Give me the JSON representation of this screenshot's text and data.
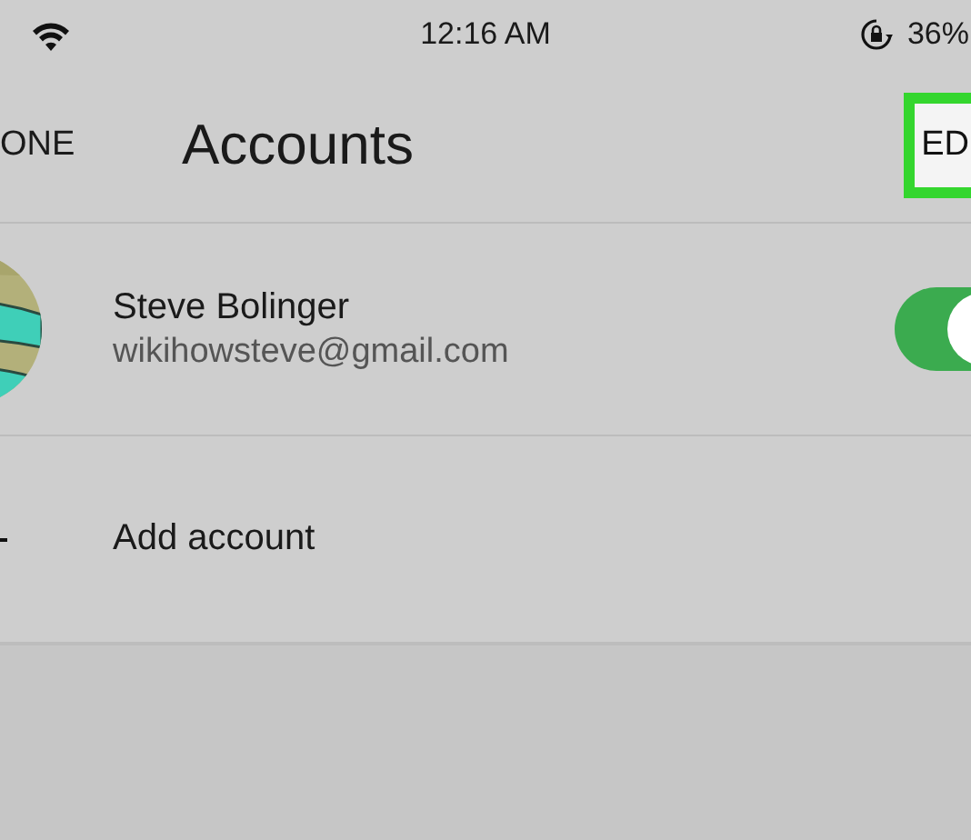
{
  "status_bar": {
    "time": "12:16 AM",
    "battery": "36%"
  },
  "nav": {
    "left_button": "ONE",
    "title": "Accounts",
    "right_button": "ED",
    "right_highlighted": true
  },
  "accounts": [
    {
      "name": "Steve Bolinger",
      "email": "wikihowsteve@gmail.com",
      "on": true
    }
  ],
  "add_account": {
    "label": "Add account"
  }
}
